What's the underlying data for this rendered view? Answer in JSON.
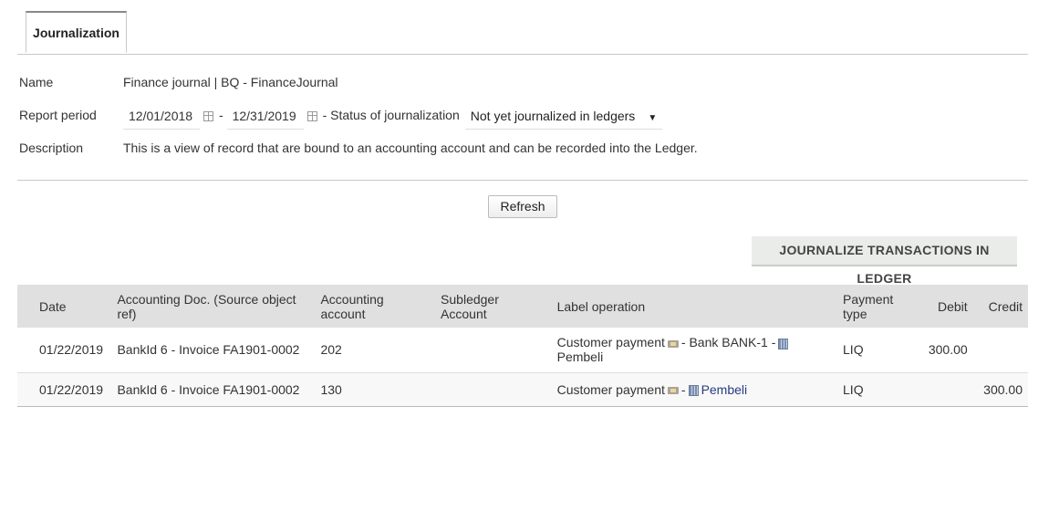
{
  "tab": {
    "label": "Journalization"
  },
  "info": {
    "name_label": "Name",
    "name_value": "Finance journal | BQ - FinanceJournal",
    "period_label": "Report period",
    "date_from": "12/01/2018",
    "date_sep": "-",
    "date_to": "12/31/2019",
    "status_label": "- Status of journalization",
    "status_value": "Not yet journalized in ledgers",
    "description_label": "Description",
    "description_value": "This is a view of record that are bound to an accounting account and can be recorded into the Ledger."
  },
  "buttons": {
    "refresh": "Refresh",
    "journalize": "JOURNALIZE TRANSACTIONS IN LEDGER"
  },
  "table": {
    "headers": {
      "date": "Date",
      "doc": "Accounting Doc. (Source object ref)",
      "account": "Accounting account",
      "subledger": "Subledger Account",
      "label": "Label operation",
      "payment": "Payment type",
      "debit": "Debit",
      "credit": "Credit"
    },
    "rows": [
      {
        "date": "01/22/2019",
        "doc": "BankId 6 - Invoice FA1901-0002",
        "account": "202",
        "subledger": "",
        "label_pre": "Customer payment",
        "label_mid": "- Bank BANK-1 -",
        "label_post": "Pembeli",
        "payment": "LIQ",
        "debit": "300.00",
        "credit": ""
      },
      {
        "date": "01/22/2019",
        "doc": "BankId 6 - Invoice FA1901-0002",
        "account": "130",
        "subledger": "",
        "label_pre": "Customer payment",
        "label_mid": "-",
        "label_post": "Pembeli",
        "payment": "LIQ",
        "debit": "",
        "credit": "300.00"
      }
    ]
  }
}
